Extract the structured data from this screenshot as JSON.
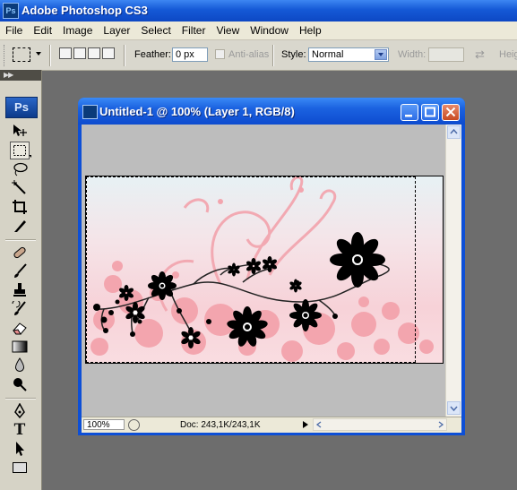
{
  "app": {
    "title": "Adobe Photoshop CS3",
    "logo_text": "Ps"
  },
  "menu": [
    "File",
    "Edit",
    "Image",
    "Layer",
    "Select",
    "Filter",
    "View",
    "Window",
    "Help"
  ],
  "options": {
    "feather_label": "Feather:",
    "feather_value": "0 px",
    "antialias_label": "Anti-alias",
    "style_label": "Style:",
    "style_value": "Normal",
    "width_label": "Width:",
    "height_label": "Heig"
  },
  "toolbox": {
    "logo": "Ps",
    "tools": [
      "move-icon",
      "marquee-icon",
      "lasso-icon",
      "magic-wand-icon",
      "crop-icon",
      "slice-icon",
      "healing-brush-icon",
      "brush-icon",
      "clone-stamp-icon",
      "history-brush-icon",
      "eraser-icon",
      "gradient-icon",
      "blur-icon",
      "dodge-icon",
      "pen-icon",
      "type-icon",
      "path-selection-icon",
      "rectangle-shape-icon"
    ]
  },
  "document": {
    "title": "Untitled-1 @ 100% (Layer 1, RGB/8)",
    "zoom": "100%",
    "doc_info": "Doc: 243,1K/243,1K"
  },
  "colors": {
    "title_blue": "#1559d6",
    "canvas_pink": "#f7d2d8",
    "flower_black": "#000000"
  }
}
